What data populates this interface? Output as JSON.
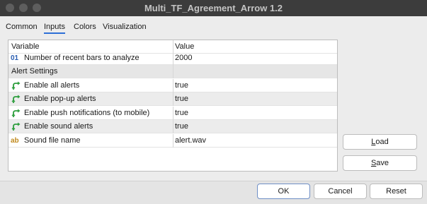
{
  "window": {
    "title": "Multi_TF_Agreement_Arrow 1.2"
  },
  "tabs": [
    {
      "label": "Common"
    },
    {
      "label": "Inputs"
    },
    {
      "label": "Colors"
    },
    {
      "label": "Visualization"
    }
  ],
  "active_tab": "Inputs",
  "grid": {
    "header": {
      "variable": "Variable",
      "value": "Value"
    },
    "rows": [
      {
        "icon_text": "01",
        "icon": "integer-icon",
        "variable": "Number of recent bars to analyze",
        "value": "2000"
      },
      {
        "variable": "Alert Settings",
        "value": ""
      },
      {
        "icon": "bool-arrow-icon",
        "variable": "Enable all alerts",
        "value": "true"
      },
      {
        "icon": "bool-arrow-icon",
        "variable": "Enable pop-up alerts",
        "value": "true"
      },
      {
        "icon": "bool-arrow-icon",
        "variable": "Enable push notifications (to mobile)",
        "value": "true"
      },
      {
        "icon": "bool-arrow-icon",
        "variable": "Enable sound alerts",
        "value": "true"
      },
      {
        "icon_text": "ab",
        "icon": "string-icon",
        "variable": "Sound file name",
        "value": "alert.wav"
      }
    ]
  },
  "side_buttons": {
    "load_prefix": "",
    "load_ul": "L",
    "load_rest": "oad",
    "save_prefix": "",
    "save_ul": "S",
    "save_rest": "ave"
  },
  "bottom_buttons": {
    "ok": "OK",
    "cancel": "Cancel",
    "reset": "Reset"
  },
  "colors": {
    "accent": "#2d6fd6",
    "int_icon": "#2a5db0",
    "string_icon": "#c08a1e",
    "bool_icon": "#2e9e3e"
  }
}
